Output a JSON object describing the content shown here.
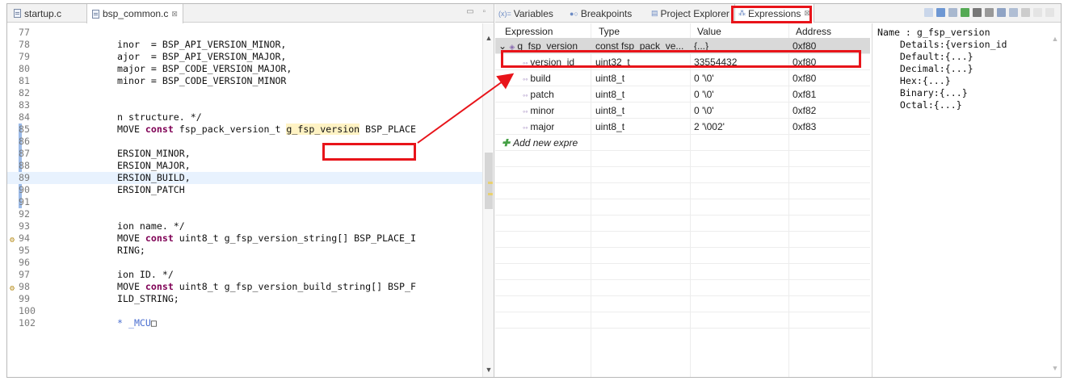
{
  "editor": {
    "tabs": [
      {
        "label": "startup.c",
        "active": false
      },
      {
        "label": "bsp_common.c",
        "active": true,
        "close": "⊠"
      }
    ],
    "pane_controls": "▭ ▫",
    "lines": [
      {
        "n": "77",
        "code": ""
      },
      {
        "n": "78",
        "code": "inor  = BSP_API_VERSION_MINOR,"
      },
      {
        "n": "79",
        "code": "ajor  = BSP_API_VERSION_MAJOR,"
      },
      {
        "n": "80",
        "code": "major = BSP_CODE_VERSION_MAJOR,"
      },
      {
        "n": "81",
        "code": "minor = BSP_CODE_VERSION_MINOR"
      },
      {
        "n": "82",
        "code": ""
      },
      {
        "n": "83",
        "code": ""
      },
      {
        "n": "84",
        "code": "n structure. */"
      },
      {
        "n": "85",
        "code_pre": "MOVE ",
        "kw": "const",
        "code_mid": " fsp_pack_version_t ",
        "code_hl": "g_fsp_version",
        "code_post": " BSP_PLACE"
      },
      {
        "n": "86",
        "code": ""
      },
      {
        "n": "87",
        "code": "ERSION_MINOR,"
      },
      {
        "n": "88",
        "code": "ERSION_MAJOR,"
      },
      {
        "n": "89",
        "code": "ERSION_BUILD,"
      },
      {
        "n": "90",
        "code": "ERSION_PATCH"
      },
      {
        "n": "91",
        "code": ""
      },
      {
        "n": "92",
        "code": ""
      },
      {
        "n": "93",
        "code": "ion name. */"
      },
      {
        "n": "94",
        "code_pre": "MOVE ",
        "kw": "const",
        "code_mid": " uint8_t g_fsp_version_string[] BSP_PLACE_I",
        "marker": "⚙"
      },
      {
        "n": "95",
        "code": "RING;"
      },
      {
        "n": "96",
        "code": ""
      },
      {
        "n": "97",
        "code": "ion ID. */"
      },
      {
        "n": "98",
        "code_pre": "MOVE ",
        "kw": "const",
        "code_mid": " uint8_t g_fsp_version_build_string[] BSP_F",
        "marker": "⚙"
      },
      {
        "n": "99",
        "code": "ILD_STRING;"
      },
      {
        "n": "100",
        "code": ""
      },
      {
        "n": "102",
        "code_hyper": "* _MCU",
        "code_box": "□"
      }
    ]
  },
  "views": {
    "tabs": [
      {
        "label": "Variables",
        "icon": "(x)="
      },
      {
        "label": "Breakpoints",
        "icon": "●○"
      },
      {
        "label": "Project Explorer",
        "icon": "▤"
      },
      {
        "label": "Expressions",
        "icon": "⁂",
        "active": true,
        "close": "⊠"
      }
    ]
  },
  "expressions": {
    "columns": [
      "Expression",
      "Type",
      "Value",
      "Address"
    ],
    "rows": [
      {
        "expr": "g_fsp_version",
        "type": "const fsp_pack_ve...",
        "value": "{...}",
        "address": "0xf80",
        "expanded": "⌄",
        "selected": true
      },
      {
        "expr": "version_id",
        "type": "uint32_t",
        "value": "33554432",
        "address": "0xf80"
      },
      {
        "expr": "build",
        "type": "uint8_t",
        "value": "0 '\\0'",
        "address": "0xf80"
      },
      {
        "expr": "patch",
        "type": "uint8_t",
        "value": "0 '\\0'",
        "address": "0xf81"
      },
      {
        "expr": "minor",
        "type": "uint8_t",
        "value": "0 '\\0'",
        "address": "0xf82"
      },
      {
        "expr": "major",
        "type": "uint8_t",
        "value": "2 '\\002'",
        "address": "0xf83"
      }
    ],
    "add_new": "Add new expre"
  },
  "details": [
    "Name : g_fsp_version",
    "    Details:{version_id",
    "    Default:{...}",
    "    Decimal:{...}",
    "    Hex:{...}",
    "    Binary:{...}",
    "    Octal:{...}"
  ],
  "colors": {
    "annotation": "#e8141a",
    "keyword": "#7f0055",
    "selection": "#d9d9d9"
  }
}
